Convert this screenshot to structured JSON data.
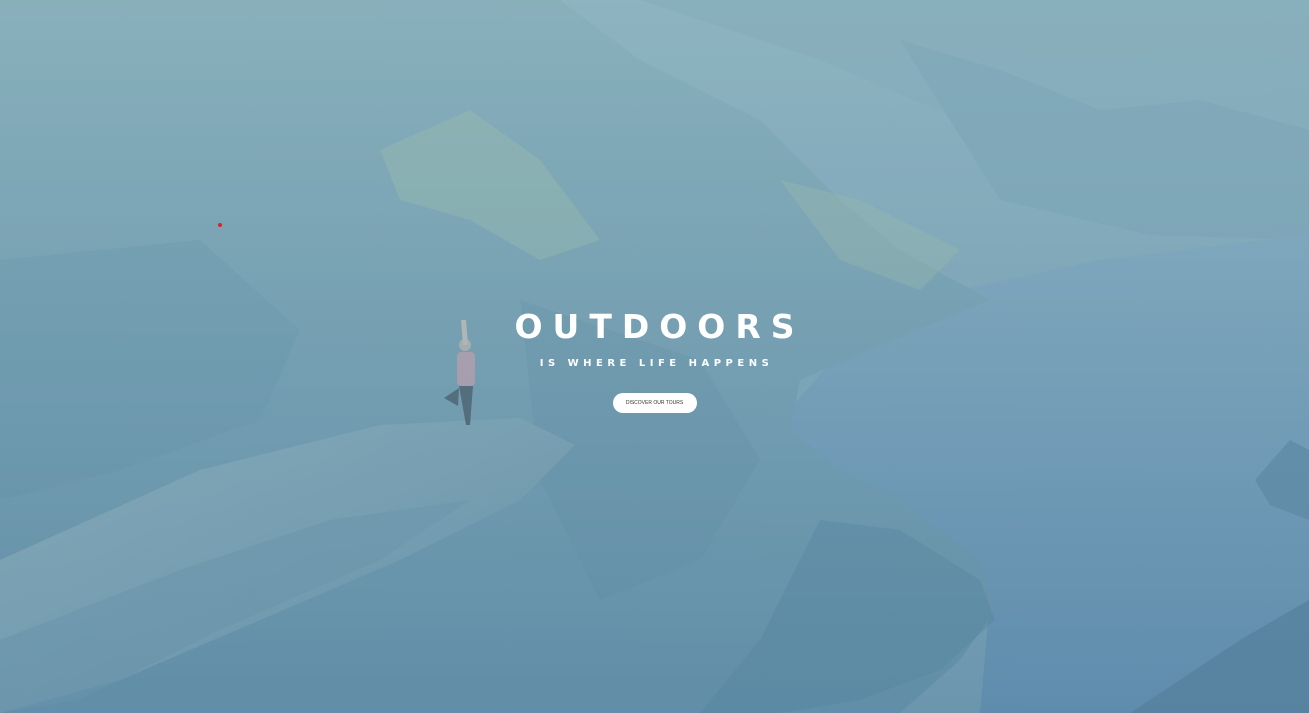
{
  "hero": {
    "title": "OUTDOORS",
    "subtitle": "IS WHERE LIFE HAPPENS",
    "button_label": "DISCOVER OUR TOURS",
    "background_image": "mountain-fjord-yoga-photo"
  },
  "colors": {
    "overlay": "#7da3b3",
    "text": "#ffffff",
    "button_bg": "#ffffff",
    "button_text": "#333333",
    "pointer_dot": "#d7262b"
  }
}
